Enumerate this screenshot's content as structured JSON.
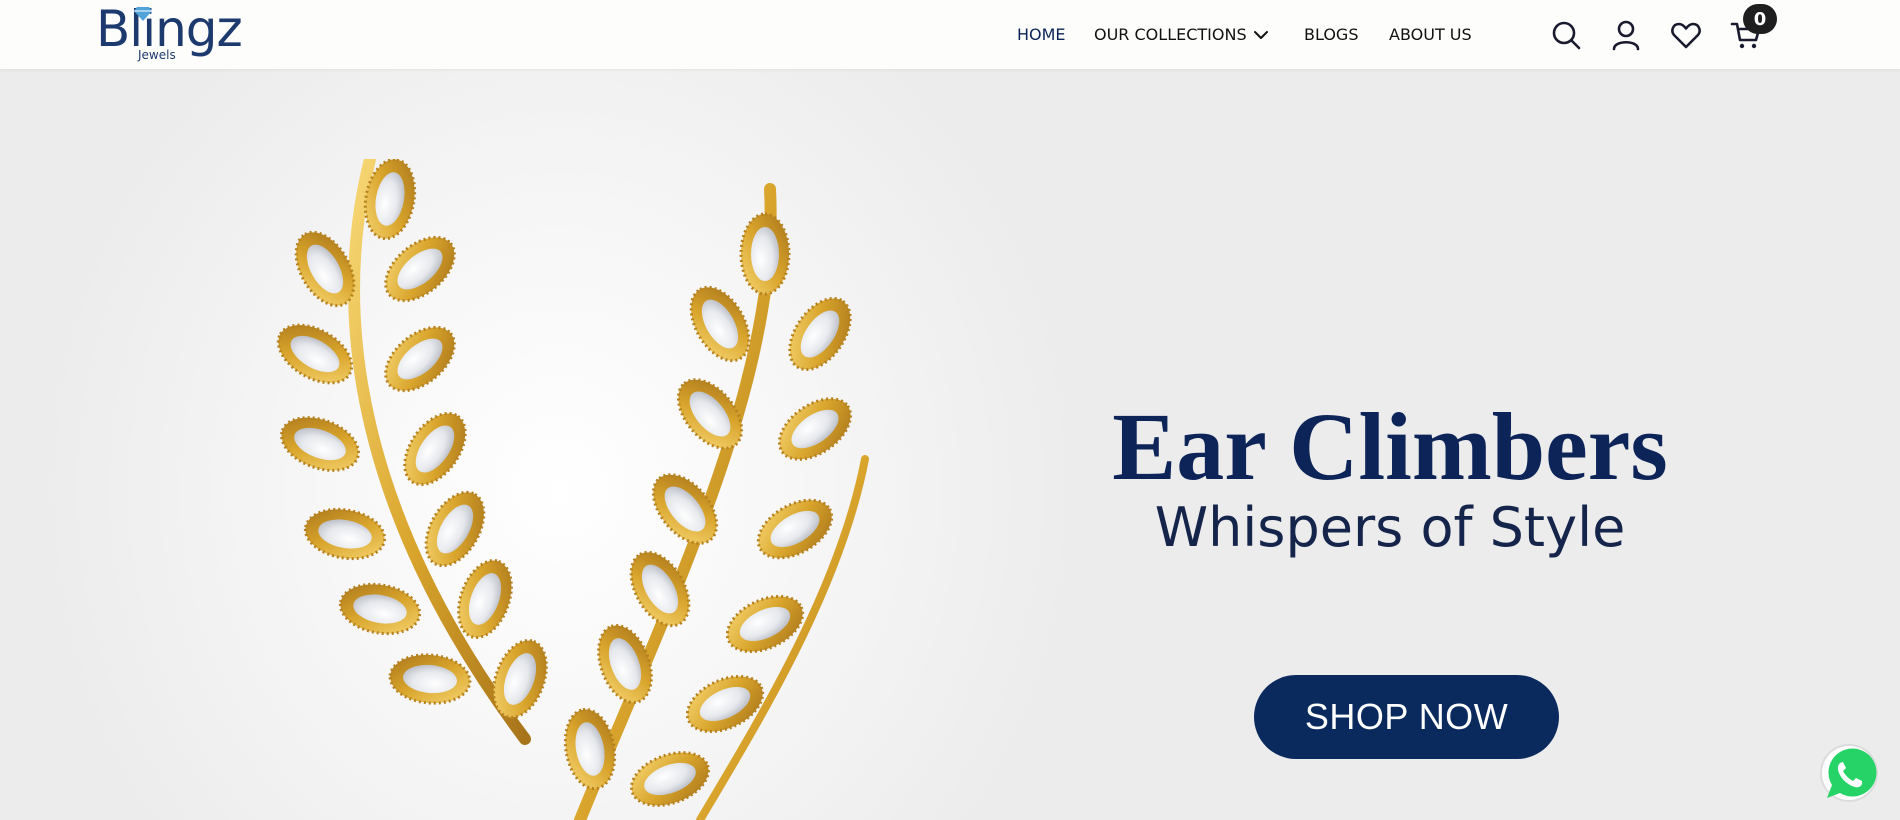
{
  "brand": {
    "name": "Blingz",
    "sub": "Jewels",
    "color": "#1d3a6e",
    "gem_color": "#4fa3d8"
  },
  "nav": {
    "items": [
      {
        "label": "HOME",
        "active": true
      },
      {
        "label": "OUR COLLECTIONS",
        "active": false
      },
      {
        "label": "BLOGS",
        "active": false
      },
      {
        "label": "ABOUT US",
        "active": false
      }
    ],
    "dropdown_icon": "chevron-down-icon"
  },
  "header_icons": {
    "search": "search-icon",
    "account": "user-icon",
    "wishlist": "heart-icon",
    "cart": "cart-icon",
    "cart_count": "0"
  },
  "hero": {
    "title": "Ear Climbers",
    "subtitle": "Whispers of Style",
    "cta_label": "SHOP NOW",
    "title_color": "#0d2459",
    "button_color": "#0a2a5e",
    "image": "gold-leaf-ear-climbers-image"
  },
  "floating": {
    "whatsapp": "whatsapp-icon",
    "color": "#25d366"
  }
}
